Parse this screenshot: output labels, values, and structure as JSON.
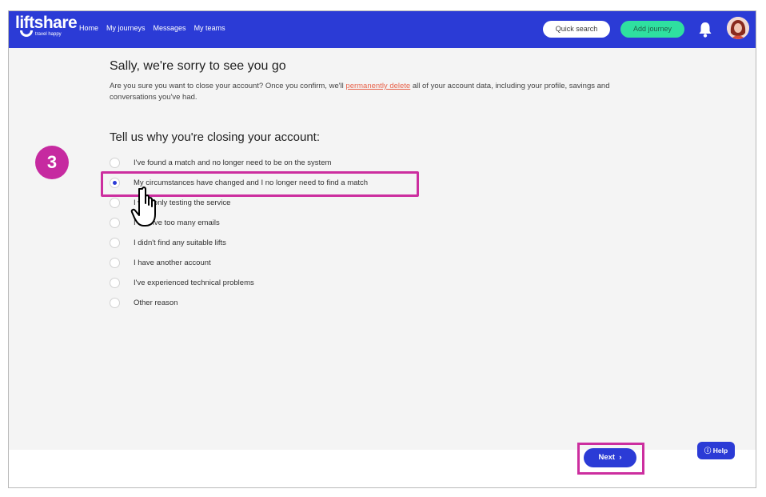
{
  "header": {
    "logo_text": "liftshare",
    "logo_tagline": "travel happy",
    "nav": [
      "Home",
      "My journeys",
      "Messages",
      "My teams"
    ],
    "quick_search_label": "Quick search",
    "add_journey_label": "Add journey",
    "bell_icon": "bell-icon",
    "avatar_icon": "user-avatar"
  },
  "main": {
    "title": "Sally, we're sorry to see you go",
    "intro_before": "Are you sure you want to close your account? Once you confirm, we'll ",
    "intro_link": "permanently delete",
    "intro_after": " all of your account data, including your profile, savings and conversations you've had.",
    "reasons_heading": "Tell us why you're closing your account:",
    "reasons": [
      "I've found a match and no longer need to be on the system",
      "My circumstances have changed and I no longer need to find a match",
      "I was only testing the service",
      "I receive too many emails",
      "I didn't find any suitable lifts",
      "I have another account",
      "I've experienced technical problems",
      "Other reason"
    ],
    "selected_index": 1
  },
  "footer": {
    "next_label": "Next",
    "next_icon": "chevron-right-icon",
    "help_label": "Help",
    "help_icon": "question-circle-icon"
  },
  "annotation": {
    "step_number": "3",
    "cursor_icon": "hand-pointer-icon"
  },
  "colors": {
    "brand_blue": "#2b3bd6",
    "accent_green": "#2fe0a0",
    "highlight_magenta": "#cc2e9f",
    "danger_link": "#e8624a",
    "background": "#f4f4f4"
  }
}
